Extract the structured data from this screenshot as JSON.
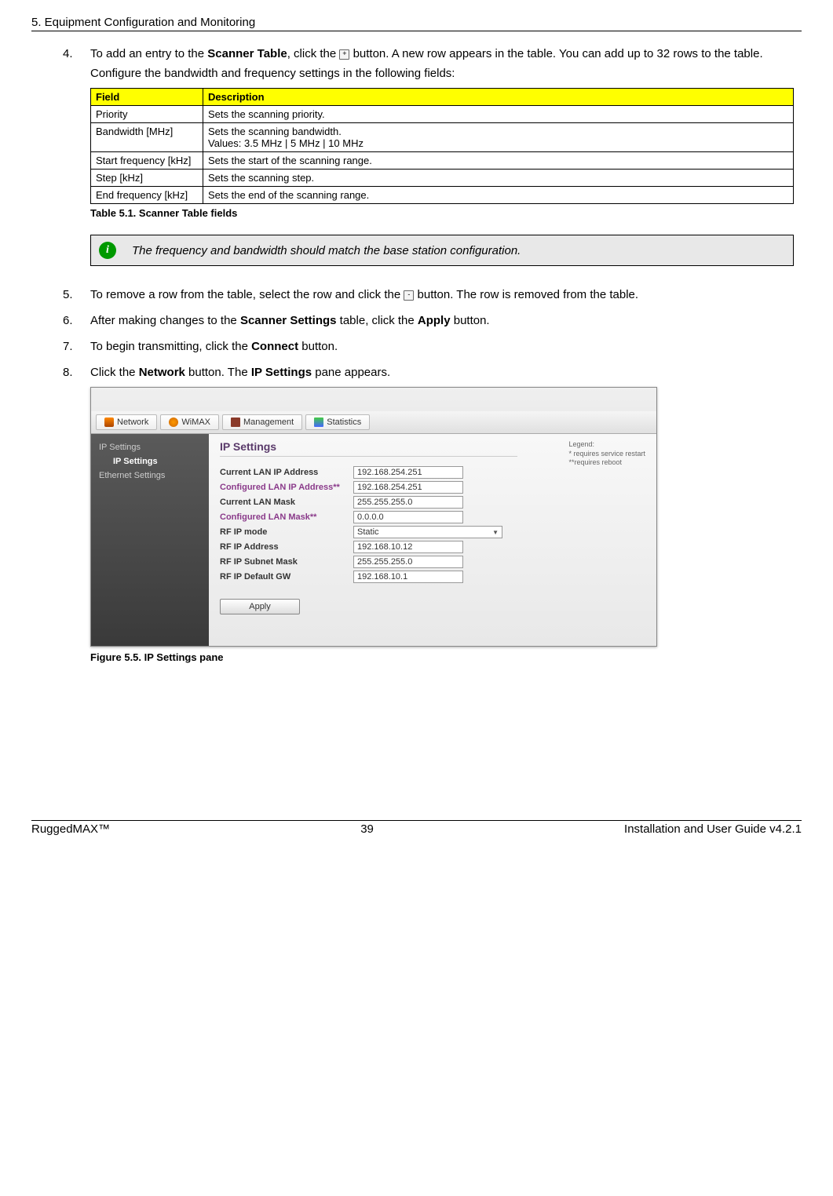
{
  "header": "5. Equipment Configuration and Monitoring",
  "step4": {
    "num": "4.",
    "p1_pre": "To add an entry to the ",
    "p1_bold1": "Scanner Table",
    "p1_mid": ", click the ",
    "p1_btn": "+",
    "p1_post": " button. A new row appears in the table. You can add up to 32 rows to the table.",
    "p2": "Configure the bandwidth and frequency settings in the following fields:"
  },
  "table": {
    "h1": "Field",
    "h2": "Description",
    "rows": [
      {
        "f": "Priority",
        "d": "Sets the scanning priority."
      },
      {
        "f": "Bandwidth [MHz]",
        "d": "Sets the scanning bandwidth.",
        "d2": "Values: 3.5 MHz | 5 MHz | 10 MHz"
      },
      {
        "f": "Start frequency [kHz]",
        "d": "Sets the start of the scanning range."
      },
      {
        "f": "Step [kHz]",
        "d": "Sets the scanning step."
      },
      {
        "f": "End frequency [kHz]",
        "d": "Sets the end of the scanning range."
      }
    ],
    "caption": "Table 5.1. Scanner Table fields"
  },
  "note": {
    "icon": "i",
    "text": "The frequency and bandwidth should match the base station configuration."
  },
  "step5": {
    "num": "5.",
    "pre": "To remove a row from the table, select the row and click the ",
    "btn": "-",
    "post": " button. The row is removed from the table."
  },
  "step6": {
    "num": "6.",
    "pre": "After making changes to the ",
    "b1": "Scanner Settings",
    "mid": " table, click the ",
    "b2": "Apply",
    "post": " button."
  },
  "step7": {
    "num": "7.",
    "pre": "To begin transmitting, click the ",
    "b1": "Connect",
    "post": " button."
  },
  "step8": {
    "num": "8.",
    "pre": "Click the ",
    "b1": "Network",
    "mid": " button. The ",
    "b2": "IP Settings",
    "post": " pane appears."
  },
  "screenshot": {
    "tabs": {
      "network": "Network",
      "wimax": "WiMAX",
      "mgmt": "Management",
      "stats": "Statistics"
    },
    "sidebar": {
      "ip": "IP Settings",
      "ipsub": "IP Settings",
      "eth": "Ethernet Settings"
    },
    "legend": {
      "title": "Legend:",
      "l1": "* requires service restart",
      "l2": "**requires reboot"
    },
    "title": "IP Settings",
    "rows": [
      {
        "label": "Current LAN IP Address",
        "val": "192.168.254.251",
        "purple": false
      },
      {
        "label": "Configured LAN IP Address**",
        "val": "192.168.254.251",
        "purple": true
      },
      {
        "label": "Current LAN Mask",
        "val": "255.255.255.0",
        "purple": false
      },
      {
        "label": "Configured LAN Mask**",
        "val": "0.0.0.0",
        "purple": true
      },
      {
        "label": "RF IP mode",
        "val": "Static",
        "purple": false,
        "select": true
      },
      {
        "label": "RF IP Address",
        "val": "192.168.10.12",
        "purple": false
      },
      {
        "label": "RF IP Subnet Mask",
        "val": "255.255.255.0",
        "purple": false
      },
      {
        "label": "RF IP Default GW",
        "val": "192.168.10.1",
        "purple": false
      }
    ],
    "apply": "Apply"
  },
  "figcaption": "Figure 5.5. IP Settings pane",
  "footer": {
    "left": "RuggedMAX™",
    "center": "39",
    "right": "Installation and User Guide v4.2.1"
  }
}
